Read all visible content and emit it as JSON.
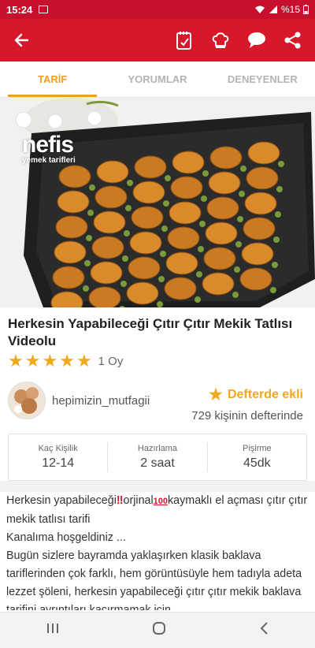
{
  "status_bar": {
    "time": "15:24",
    "battery": "%15"
  },
  "app_bar": {
    "back_icon": "arrow-left-icon",
    "actions": [
      "notebook-icon",
      "chef-hat-icon",
      "comment-icon",
      "share-icon"
    ],
    "color": "#d7182a"
  },
  "tabs": [
    {
      "label": "TARİF",
      "active": true
    },
    {
      "label": "YORUMLAR",
      "active": false
    },
    {
      "label": "DENEYENLER",
      "active": false
    }
  ],
  "hero": {
    "logo_main": "nefis",
    "logo_sub": "yemek tarifleri"
  },
  "recipe": {
    "title": "Herkesin Yapabileceği Çıtır Çıtır Mekik Tatlısı Videolu",
    "stars": 5,
    "votes": "1 Oy"
  },
  "author": {
    "name": "hepimizin_mutfagii",
    "notebook_label": "Defterde ekli",
    "notebook_count": "729 kişinin defterinde"
  },
  "info": [
    {
      "label": "Kaç Kişilik",
      "value": "12-14"
    },
    {
      "label": "Hazırlama",
      "value": "2 saat"
    },
    {
      "label": "Pişirme",
      "value": "45dk"
    }
  ],
  "description": {
    "line1_a": "Herkesin yapabileceği",
    "line1_b": "orjinal",
    "line1_c": "kaymaklı el açması çıtır çıtır mekik tatlısı tarifi",
    "line2": "Kanalıma hoşgeldiniz ...",
    "line3": "Bugün sizlere bayramda yaklaşırken klasik baklava tariflerinden çok farklı, hem görüntüsüyle hem tadıyla adeta lezzet şöleni, herkesin yapabileceği çıtır çıtır mekik baklava tarifini ayrıntıları kaçırmamak için"
  },
  "nav": [
    "recents-icon",
    "home-icon",
    "back-icon"
  ],
  "accent": "#f2a81c"
}
